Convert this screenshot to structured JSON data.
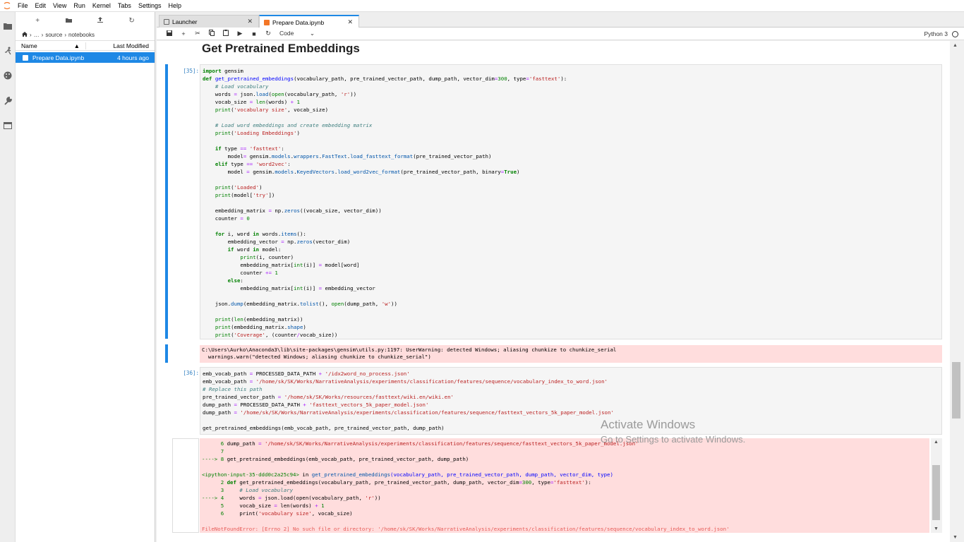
{
  "menu": [
    "File",
    "Edit",
    "View",
    "Run",
    "Kernel",
    "Tabs",
    "Settings",
    "Help"
  ],
  "file_browser": {
    "breadcrumb": [
      "…",
      "source",
      "notebooks"
    ],
    "col_name": "Name",
    "col_modified": "Last Modified",
    "files": [
      {
        "name": "Prepare Data.ipynb",
        "modified": "4 hours ago"
      }
    ]
  },
  "tabs": [
    {
      "label": "Launcher"
    },
    {
      "label": "Prepare Data.ipynb"
    }
  ],
  "toolbar": {
    "cell_type": "Code",
    "kernel": "Python 3"
  },
  "notebook": {
    "heading": "Get Pretrained Embeddings",
    "cell35_prompt": "[35]:",
    "cell36_prompt": "[36]:",
    "warning_line1": "C:\\Users\\Aurko\\Anaconda3\\lib\\site-packages\\gensim\\utils.py:1197: UserWarning: detected Windows; aliasing chunkize to chunkize_serial",
    "warning_line2": "  warnings.warn(\"detected Windows; aliasing chunkize to chunkize_serial\")",
    "error_message": "FileNotFoundError: [Errno 2] No such file or directory: '/home/sk/SK/Works/NarrativeAnalysis/experiments/classification/features/sequence/vocabulary_index_to_word.json'"
  },
  "watermark": {
    "line1": "Activate Windows",
    "line2": "Go to Settings to activate Windows."
  }
}
